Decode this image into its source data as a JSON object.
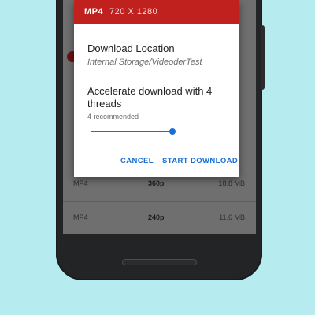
{
  "dialog": {
    "format": "MP4",
    "resolution": "720 X 1280",
    "location_label": "Download Location",
    "location_value": "Internal Storage/VideoderTest",
    "threads_label": "Accelerate download with 4 threads",
    "threads_hint": "4 recommended",
    "threads_slider_fraction": 0.6,
    "cancel_label": "CANCEL",
    "start_label": "START DOWNLOAD"
  },
  "list": {
    "rows": [
      {
        "format": "MP4",
        "resolution": "360p",
        "size": "18.8 MB"
      },
      {
        "format": "MP4",
        "resolution": "240p",
        "size": "11.6 MB"
      }
    ]
  },
  "colors": {
    "header_red": "#c0211f",
    "accent_blue": "#1a6fd4",
    "background": "#b6ecf0"
  }
}
